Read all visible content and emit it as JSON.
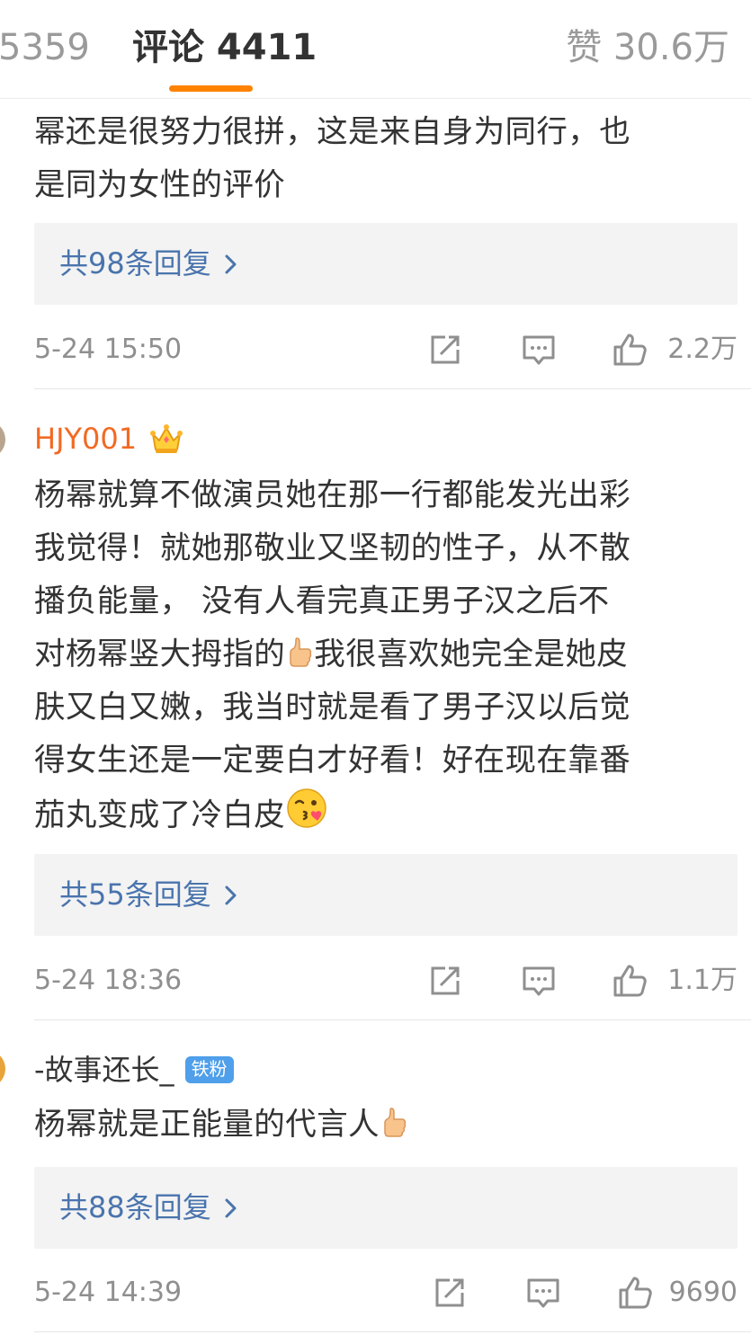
{
  "tabs": {
    "reposts_count": "5359",
    "comments_label": "评论 4411",
    "likes_label": "赞 30.6万"
  },
  "comments": [
    {
      "text_lines": [
        "幂还是很努力很拼，这是来自身为同行，也",
        "是同为女性的评价"
      ],
      "replies_label": "共98条回复",
      "time": "5-24 15:50",
      "likes": "2.2万"
    },
    {
      "username": "HJY001",
      "badge": "crown-icon",
      "text_lines": [
        "杨幂就算不做演员她在那一行都能发光出彩",
        "我觉得！就她那敬业又坚韧的性子，从不散",
        "播负能量，  没有人看完真正男子汉之后不",
        "对杨幂竖大拇指的",
        "我很喜欢她完全是她皮",
        "肤又白又嫩，我当时就是看了男子汉以后觉",
        "得女生还是一定要白才好看！好在现在靠番",
        "茄丸变成了冷白皮"
      ],
      "replies_label": "共55条回复",
      "time": "5-24 18:36",
      "likes": "1.1万"
    },
    {
      "username": "-故事还长_",
      "badge_label": "铁粉",
      "text": "杨幂就是正能量的代言人",
      "replies_label": "共88条回复",
      "time": "5-24 14:39",
      "likes": "9690"
    }
  ],
  "colors": {
    "accent": "#ff8200",
    "link": "#4a74ad",
    "username_vip": "#f26a22",
    "fan_badge": "#4f9fea",
    "muted": "#8f8f8f"
  },
  "icons": [
    "share-icon",
    "comment-icon",
    "thumbs-up-icon",
    "chevron-right-icon",
    "crown-icon",
    "thumbs-up-emoji",
    "kiss-emoji"
  ]
}
